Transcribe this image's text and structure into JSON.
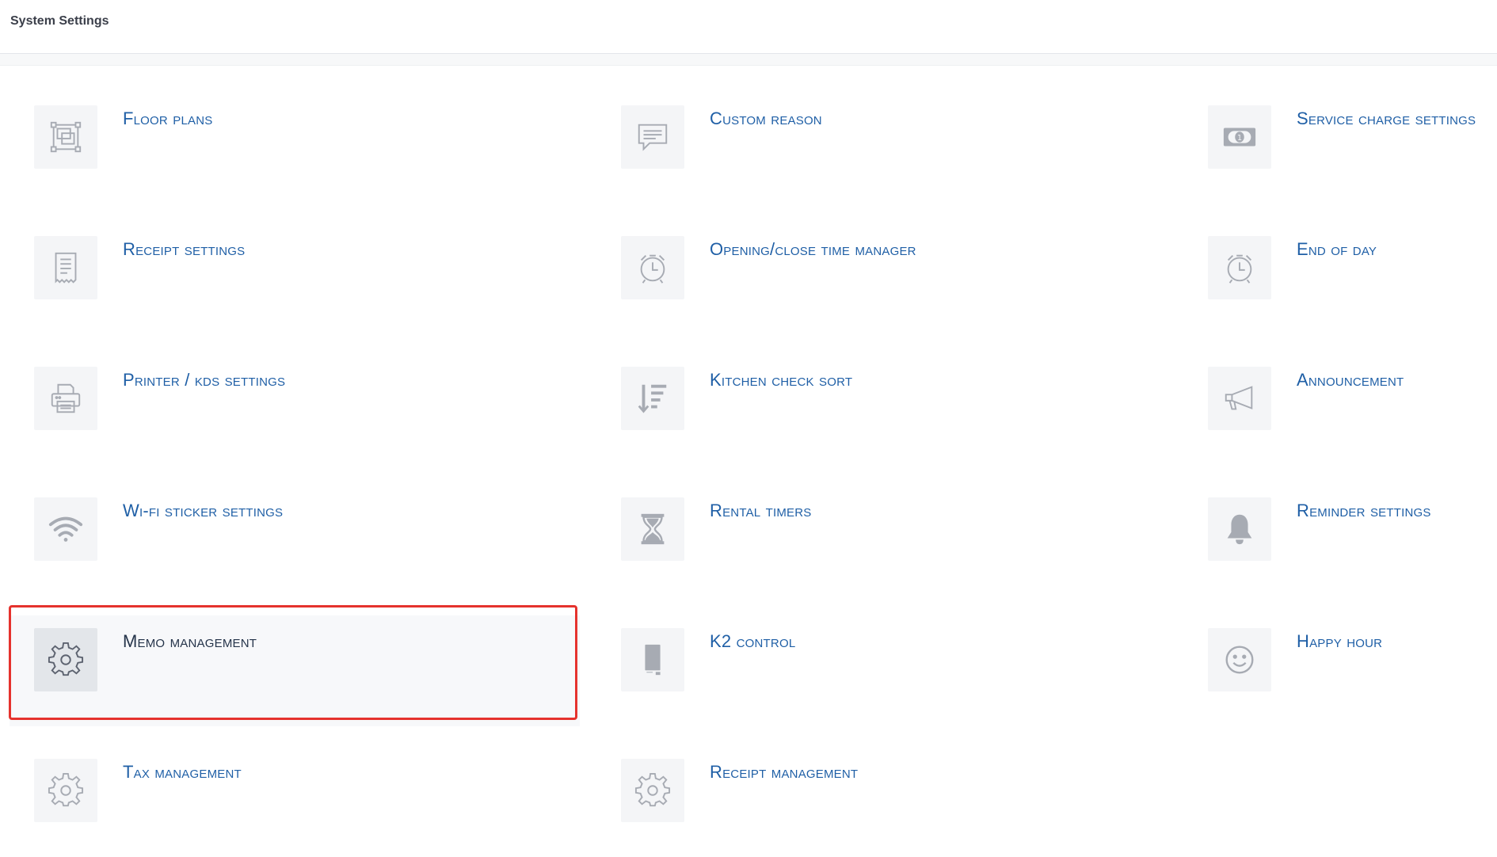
{
  "header": {
    "title": "System Settings"
  },
  "items": [
    {
      "label": "Floor plans",
      "icon": "floor-plan-icon"
    },
    {
      "label": "Custom reason",
      "icon": "message-icon"
    },
    {
      "label": "Service charge settings",
      "icon": "money-icon"
    },
    {
      "label": "Receipt settings",
      "icon": "receipt-icon"
    },
    {
      "label": "Opening/close time manager",
      "icon": "alarm-clock-icon"
    },
    {
      "label": "End of day",
      "icon": "alarm-clock-icon"
    },
    {
      "label": "Printer / kds settings",
      "icon": "printer-icon"
    },
    {
      "label": "Kitchen check sort",
      "icon": "sort-icon"
    },
    {
      "label": "Announcement",
      "icon": "megaphone-icon"
    },
    {
      "label": "Wi-fi sticker settings",
      "icon": "wifi-icon"
    },
    {
      "label": "Rental timers",
      "icon": "hourglass-icon"
    },
    {
      "label": "Reminder settings",
      "icon": "bell-icon"
    },
    {
      "label": "Memo management",
      "icon": "gear-icon",
      "selected": true
    },
    {
      "label": "K2 control",
      "icon": "device-icon"
    },
    {
      "label": "Happy hour",
      "icon": "smiley-icon"
    },
    {
      "label": "Tax management",
      "icon": "gear-icon"
    },
    {
      "label": "Receipt management",
      "icon": "gear-icon"
    }
  ],
  "colors": {
    "label": "#1f5fa6",
    "selected_label": "#25344a",
    "icon": "#a7abb3",
    "highlight_border": "#e5322d"
  }
}
